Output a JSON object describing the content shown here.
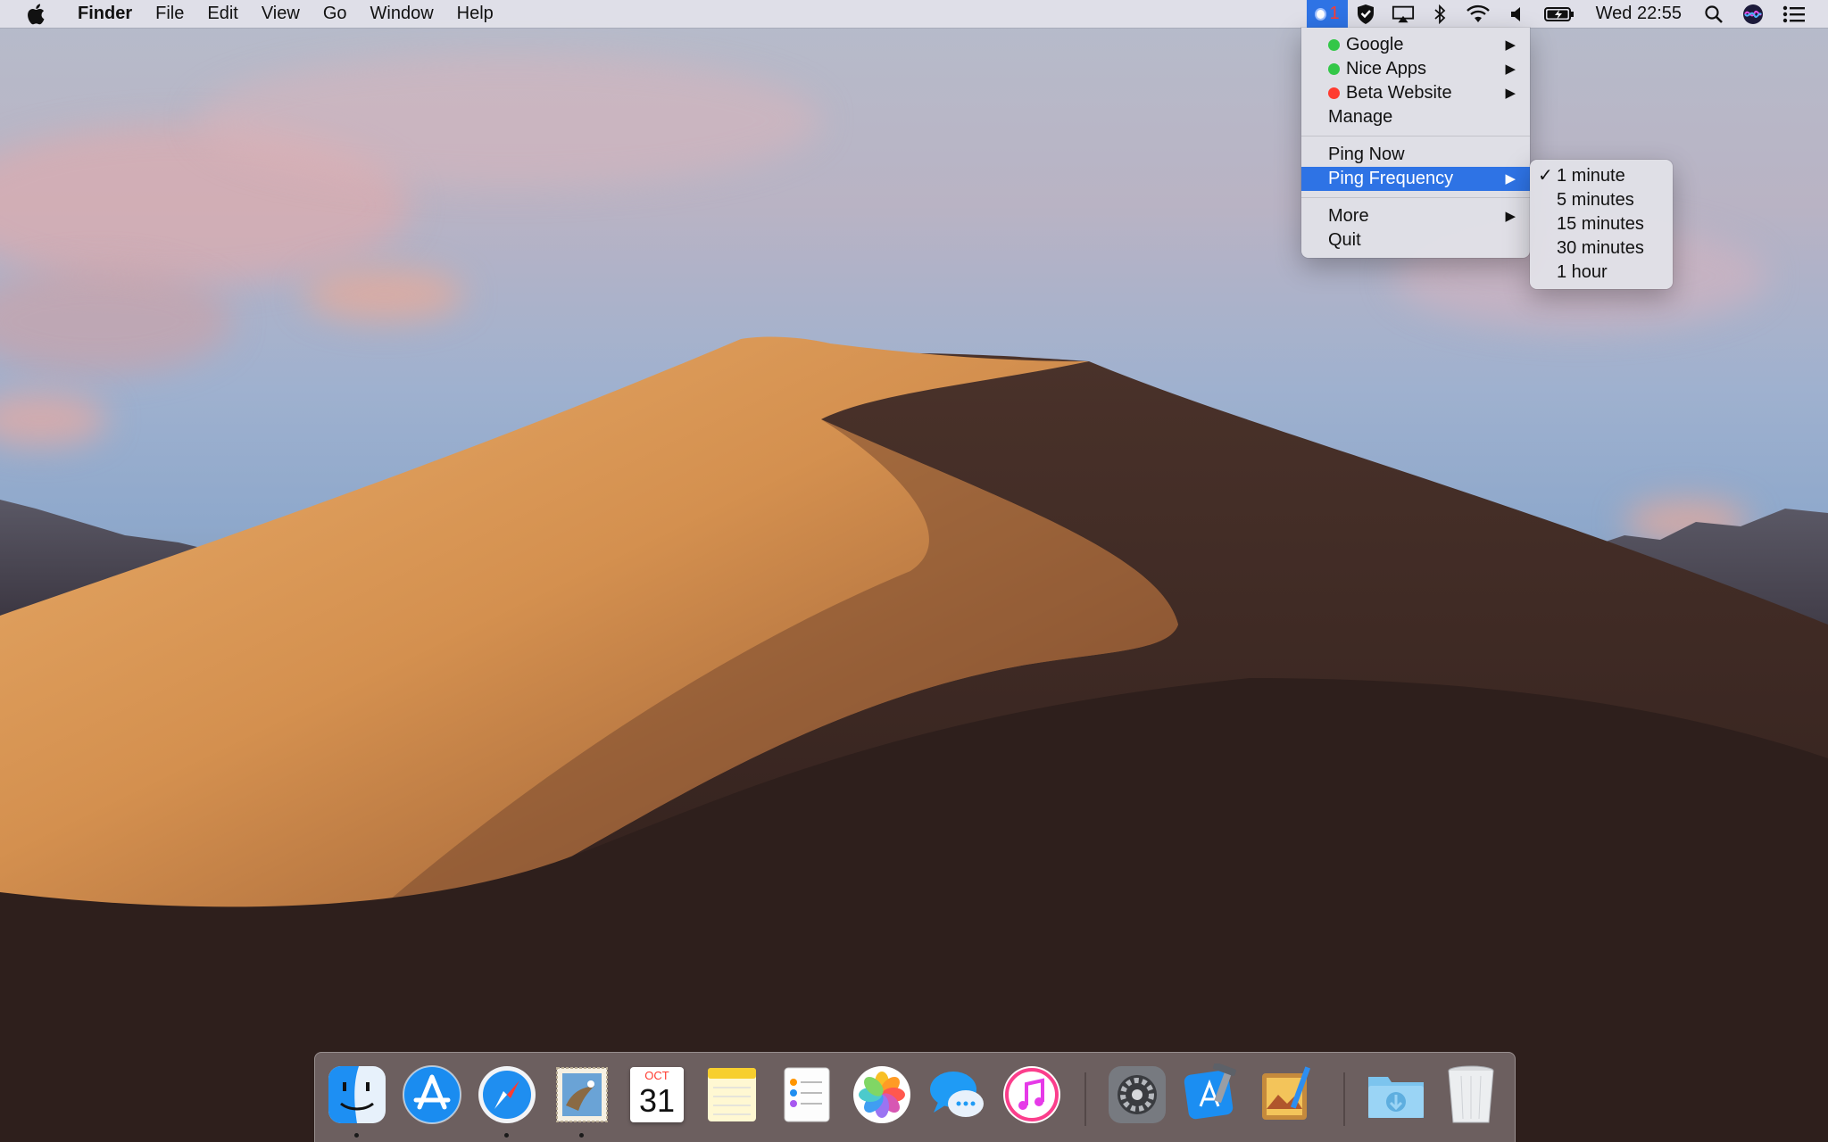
{
  "menubar": {
    "app_name": "Finder",
    "menus": [
      "File",
      "Edit",
      "View",
      "Go",
      "Window",
      "Help"
    ],
    "status": {
      "ping_badge": "1",
      "clock": "Wed 22:55",
      "icons": [
        "ping-monitor-icon",
        "shield-icon",
        "airplay-icon",
        "bluetooth-icon",
        "wifi-icon",
        "volume-icon",
        "battery-icon",
        "spotlight-icon",
        "siri-icon",
        "notification-center-icon"
      ]
    }
  },
  "ping_menu": {
    "sites": [
      {
        "label": "Google",
        "status_color": "#33c748"
      },
      {
        "label": "Nice Apps",
        "status_color": "#33c748"
      },
      {
        "label": "Beta Website",
        "status_color": "#ff3b30"
      }
    ],
    "manage": "Manage",
    "ping_now": "Ping Now",
    "ping_frequency": "Ping Frequency",
    "more": "More",
    "quit": "Quit",
    "submenu_arrow": "▶"
  },
  "frequency_submenu": {
    "checkmark": "✓",
    "options": [
      "1 minute",
      "5 minutes",
      "15 minutes",
      "30 minutes",
      "1 hour"
    ],
    "selected_index": 0
  },
  "dock": {
    "calendar_month": "OCT",
    "calendar_day": "31",
    "apps": [
      "Finder",
      "App Store",
      "Safari",
      "Mail",
      "Calendar",
      "Notes",
      "Reminders",
      "Photos",
      "Messages",
      "iTunes",
      "System Preferences",
      "Xcode",
      "Preview",
      "Downloads",
      "Trash"
    ]
  },
  "colors": {
    "menu_highlight": "#2e73e5",
    "menubar_bg": "#e8e6ee",
    "status_green": "#33c748",
    "status_red": "#ff3b30"
  }
}
